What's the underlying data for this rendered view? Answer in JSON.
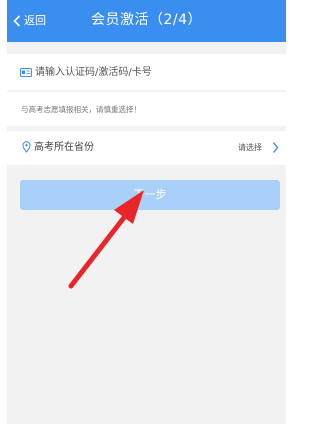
{
  "navbar": {
    "back_label": "返回",
    "title": "会员激活（2/4）"
  },
  "form": {
    "code_placeholder": "请输入认证码/激活码/卡号",
    "hint": "与高考志愿填报相关，请慎重选择！",
    "province_label": "高考所在省份",
    "province_value": "请选择",
    "next_label": "下一步"
  },
  "colors": {
    "navbar": "#3a8ef0",
    "button": "#a8d0f8",
    "annotation_arrow": "#e8262a",
    "background": "#f2f2f2"
  },
  "icons": [
    "chevron-left-icon",
    "id-card-icon",
    "location-pin-icon",
    "chevron-right-icon",
    "red-arrow"
  ]
}
